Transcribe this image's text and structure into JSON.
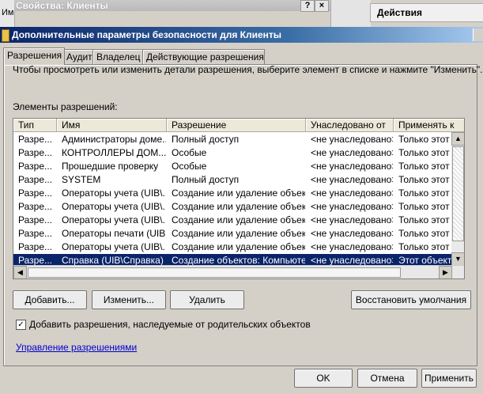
{
  "background": {
    "window_title": "Свойства: Клиенты",
    "left_edge_text": "Им",
    "actions_title": "Действия",
    "help_glyph": "?",
    "close_glyph": "×"
  },
  "dialog": {
    "title": "Дополнительные параметры безопасности для Клиенты",
    "tabs": [
      {
        "label": "Разрешения",
        "active": true
      },
      {
        "label": "Аудит",
        "active": false
      },
      {
        "label": "Владелец",
        "active": false
      },
      {
        "label": "Действующие разрешения",
        "active": false
      }
    ],
    "instruction": "Чтобы просмотреть или изменить детали разрешения, выберите элемент в списке и нажмите \"Изменить\".",
    "list_label": "Элементы разрешений:",
    "columns": [
      "Тип",
      "Имя",
      "Разрешение",
      "Унаследовано от",
      "Применять к"
    ],
    "rows": [
      [
        "Разре...",
        "Администраторы доме...",
        "Полный доступ",
        "<не унаследовано>",
        "Только этот объ"
      ],
      [
        "Разре...",
        "КОНТРОЛЛЕРЫ ДОМ...",
        "Особые",
        "<не унаследовано>",
        "Только этот объ"
      ],
      [
        "Разре...",
        "Прошедшие проверку",
        "Особые",
        "<не унаследовано>",
        "Только этот объ"
      ],
      [
        "Разре...",
        "SYSTEM",
        "Полный доступ",
        "<не унаследовано>",
        "Только этот объ"
      ],
      [
        "Разре...",
        "Операторы учета (UIB\\...",
        "Создание или удаление объек...",
        "<не унаследовано>",
        "Только этот объ"
      ],
      [
        "Разре...",
        "Операторы учета (UIB\\...",
        "Создание или удаление объек...",
        "<не унаследовано>",
        "Только этот объ"
      ],
      [
        "Разре...",
        "Операторы учета (UIB\\...",
        "Создание или удаление объек...",
        "<не унаследовано>",
        "Только этот объ"
      ],
      [
        "Разре...",
        "Операторы печати (UIB...",
        "Создание или удаление объек...",
        "<не унаследовано>",
        "Только этот объ"
      ],
      [
        "Разре...",
        "Операторы учета (UIB\\...",
        "Создание или удаление объек...",
        "<не унаследовано>",
        "Только этот объ"
      ],
      [
        "Разре...",
        "Справка (UIB\\Справка)",
        "Создание объектов: Компьютер",
        "<не унаследовано>",
        "Этот объект и..."
      ]
    ],
    "selected_row": 9,
    "buttons": {
      "add": "Добавить...",
      "edit": "Изменить...",
      "remove": "Удалить",
      "restore": "Восстановить умолчания"
    },
    "inherit_checkbox": {
      "label": "Добавить разрешения, наследуемые от родительских объектов",
      "checked": true,
      "mark": "✓"
    },
    "manage_link": "Управление разрешениями",
    "footer": {
      "ok": "OK",
      "cancel": "Отмена",
      "apply": "Применить"
    }
  }
}
